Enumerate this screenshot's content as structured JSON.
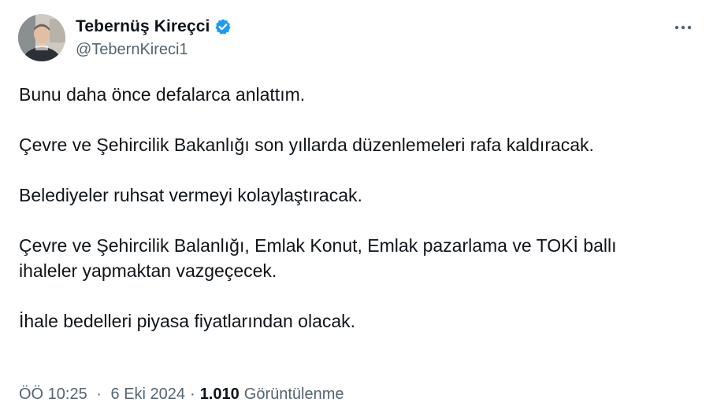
{
  "author": {
    "display_name": "Tebernüş Kireçci",
    "handle": "@TebernKireci1",
    "verified": true,
    "icons": {
      "avatar": "profile-photo",
      "verified": "verified-badge-icon",
      "more": "more-horizontal-icon"
    }
  },
  "tweet": {
    "paragraphs": [
      [
        "Bunu daha önce defalarca anlattım."
      ],
      [
        "Çevre ve Şehircilik Bakanlığı son yıllarda düzenlemeleri rafa kaldıracak."
      ],
      [
        "Belediyeler ruhsat vermeyi kolaylaştıracak."
      ],
      [
        "Çevre ve Şehircilik Balanlığı, Emlak Konut, Emlak pazarlama ve TOKİ ballı",
        "ihaleler yapmaktan vazgeçecek."
      ],
      [
        "İhale bedelleri piyasa fiyatlarından olacak."
      ]
    ]
  },
  "meta": {
    "time": "ÖÖ 10:25",
    "separator": "·",
    "date": "6 Eki 2024",
    "views_count": "1.010",
    "views_label": "Görüntülenme"
  },
  "colors": {
    "text": "#0f1419",
    "secondary": "#536471",
    "verified": "#1d9bf0"
  }
}
